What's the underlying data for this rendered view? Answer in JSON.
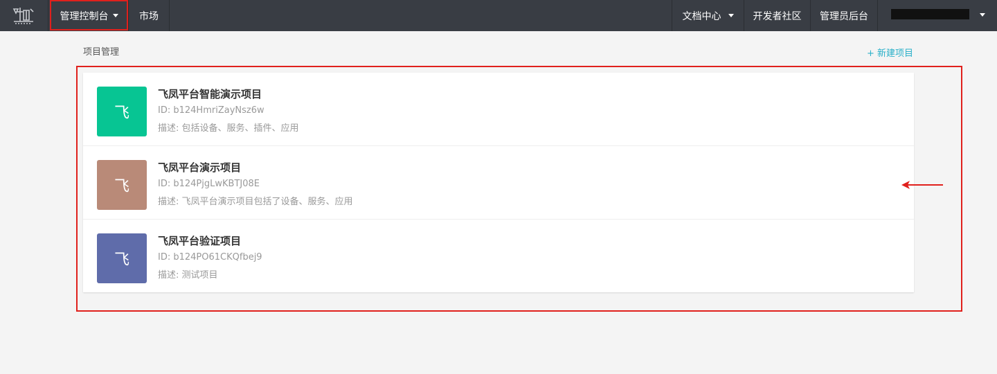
{
  "nav": {
    "console_label": "管理控制台",
    "market_label": "市场",
    "docs_label": "文档中心",
    "community_label": "开发者社区",
    "admin_label": "管理员后台"
  },
  "section": {
    "title": "项目管理",
    "new_project_label": "+ 新建项目"
  },
  "projects": [
    {
      "avatar_char": "飞",
      "avatar_color": "#07c593",
      "name": "飞凤平台智能演示项目",
      "id_text": "ID: b124HmriZayNsz6w",
      "desc_text": "描述: 包括设备、服务、插件、应用"
    },
    {
      "avatar_char": "飞",
      "avatar_color": "#b98a78",
      "name": "飞凤平台演示项目",
      "id_text": "ID: b124PjgLwKBTJ08E",
      "desc_text": "描述: 飞凤平台演示项目包括了设备、服务、应用"
    },
    {
      "avatar_char": "飞",
      "avatar_color": "#5f6caa",
      "name": "飞凤平台验证项目",
      "id_text": "ID: b124PO61CKQfbej9",
      "desc_text": "描述: 测试项目"
    }
  ],
  "colors": {
    "topbar": "#393d44",
    "accent": "#2ab0c9",
    "annotation": "#e0201c"
  }
}
